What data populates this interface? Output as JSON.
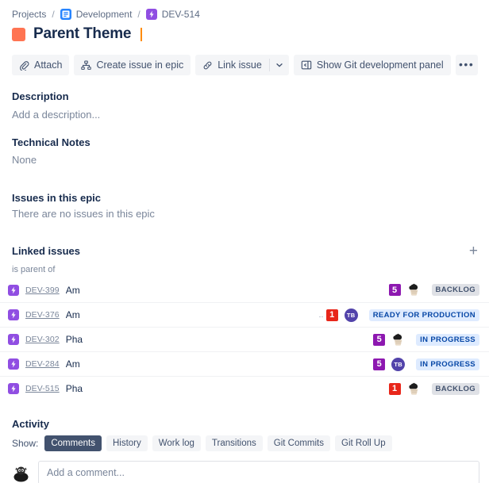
{
  "breadcrumb": {
    "projects_label": "Projects",
    "separator": "/",
    "project_name": "Development",
    "issue_key": "DEV-514"
  },
  "header": {
    "title": "Parent Theme",
    "epic_color": "#ff7452"
  },
  "toolbar": {
    "attach_label": "Attach",
    "create_issue_in_epic_label": "Create issue in epic",
    "link_issue_label": "Link issue",
    "show_git_panel_label": "Show Git development panel",
    "more_label": "•••"
  },
  "description": {
    "heading": "Description",
    "placeholder": "Add a description..."
  },
  "technical_notes": {
    "heading": "Technical Notes",
    "value": "None"
  },
  "issues_in_epic": {
    "heading": "Issues in this epic",
    "empty_text": "There are no issues in this epic"
  },
  "linked_issues": {
    "heading": "Linked issues",
    "add_label": "+",
    "relationship_label": "is parent of",
    "rows": [
      {
        "key": "DEV-399",
        "summary": "Am",
        "leading_dots": "",
        "priority": "5",
        "priority_class": "p5",
        "avatar_type": "photo",
        "avatar_initials": "",
        "status": "BACKLOG",
        "status_class": "lz-gray"
      },
      {
        "key": "DEV-376",
        "summary": "Am",
        "leading_dots": "..",
        "priority": "1",
        "priority_class": "p1",
        "avatar_type": "initials",
        "avatar_initials": "TB",
        "status": "READY FOR PRODUCTION",
        "status_class": "lz-blue"
      },
      {
        "key": "DEV-302",
        "summary": "Pha",
        "leading_dots": "",
        "priority": "5",
        "priority_class": "p5",
        "avatar_type": "photo",
        "avatar_initials": "",
        "status": "IN PROGRESS",
        "status_class": "lz-blue"
      },
      {
        "key": "DEV-284",
        "summary": "Am",
        "leading_dots": "",
        "priority": "5",
        "priority_class": "p5",
        "avatar_type": "initials",
        "avatar_initials": "TB",
        "status": "IN PROGRESS",
        "status_class": "lz-blue"
      },
      {
        "key": "DEV-515",
        "summary": "Pha",
        "leading_dots": "",
        "priority": "1",
        "priority_class": "p1",
        "avatar_type": "photo",
        "avatar_initials": "",
        "status": "BACKLOG",
        "status_class": "lz-gray"
      }
    ]
  },
  "activity": {
    "heading": "Activity",
    "show_label": "Show:",
    "tabs": [
      {
        "label": "Comments",
        "active": true
      },
      {
        "label": "History",
        "active": false
      },
      {
        "label": "Work log",
        "active": false
      },
      {
        "label": "Transitions",
        "active": false
      },
      {
        "label": "Git Commits",
        "active": false
      },
      {
        "label": "Git Roll Up",
        "active": false
      }
    ],
    "comment_placeholder": "Add a comment..."
  }
}
